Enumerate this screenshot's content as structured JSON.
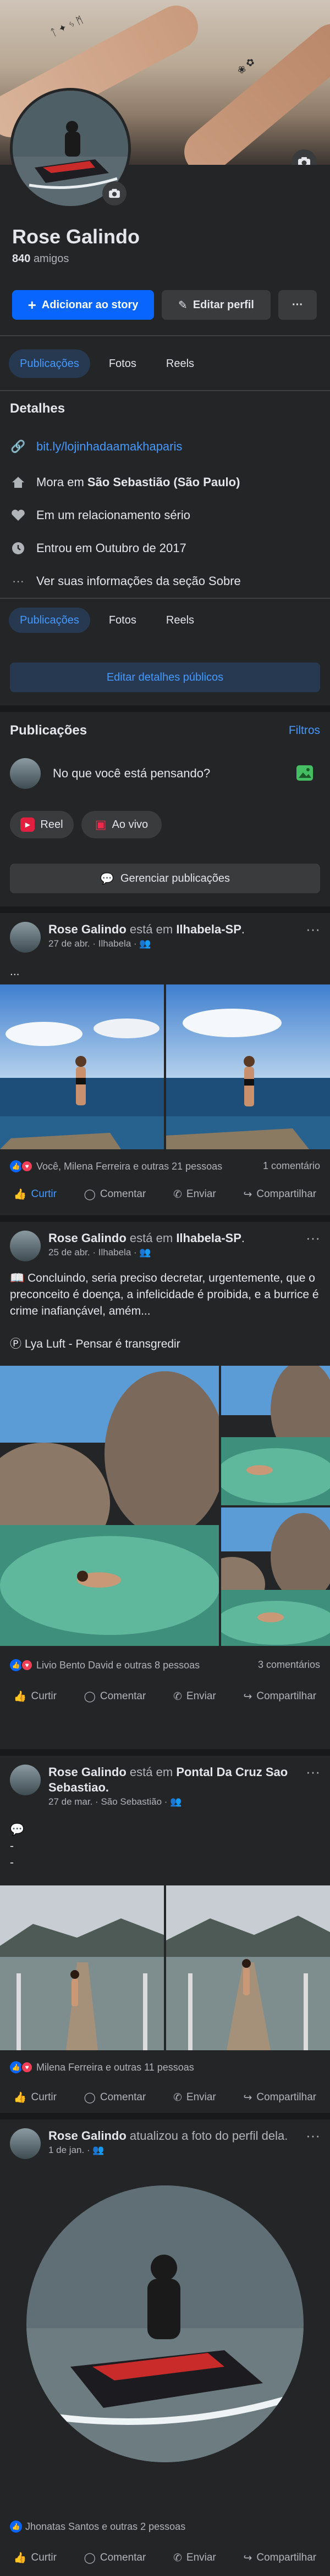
{
  "profile": {
    "name": "Rose Galindo",
    "friends_count": "840",
    "friends_label": "amigos",
    "add_story": "Adicionar ao story",
    "edit_profile": "Editar perfil",
    "more": "···"
  },
  "tabs": [
    "Publicações",
    "Fotos",
    "Reels"
  ],
  "details": {
    "title": "Detalhes",
    "link": "bit.ly/lojinhadaamakhaparis",
    "lives_prefix": "Mora em",
    "lives_place": "São Sebastião (São Paulo)",
    "relationship": "Em um relacionamento sério",
    "joined": "Entrou em Outubro de 2017",
    "about": "Ver suas informações da seção Sobre",
    "edit_public": "Editar detalhes públicos"
  },
  "posts_section": {
    "title": "Publicações",
    "filters": "Filtros",
    "composer_placeholder": "No que você está pensando?",
    "reel": "Reel",
    "live": "Ao vivo",
    "manage": "Gerenciar publicações"
  },
  "actions": {
    "like": "Curtir",
    "like_active": "Curtir",
    "comment": "Comentar",
    "send": "Enviar",
    "share": "Compartilhar"
  },
  "posts": [
    {
      "author": "Rose Galindo",
      "verb": "está em",
      "place": "Ilhabela-SP",
      "punct": ".",
      "date": "27 de abr.",
      "loc": "Ilhabela",
      "text": "...",
      "reactions": "Você, Milena Ferreira e outras 21 pessoas",
      "comments": "1 comentário"
    },
    {
      "author": "Rose Galindo",
      "verb": "está em",
      "place": "Ilhabela-SP",
      "punct": ".",
      "date": "25 de abr.",
      "loc": "Ilhabela",
      "text": "📖 Concluindo, seria preciso decretar, urgentemente, que o preconceito é doença, a infelicidade é proibida, e a burrice é crime inafiançável, amém...",
      "text2": "Lya Luft - Pensar é transgredir",
      "reactions": "Livio Bento David e outras 8 pessoas",
      "comments": "3 comentários"
    },
    {
      "author": "Rose Galindo",
      "verb": "está em",
      "place": "Pontal Da Cruz Sao Sebastiao.",
      "punct": "",
      "date": "27 de mar.",
      "loc": "São Sebastião",
      "text": "-",
      "text2": "-",
      "reactions": "Milena Ferreira e outras 11 pessoas",
      "comments": ""
    },
    {
      "author": "Rose Galindo",
      "verb": "atualizou a foto do perfil dela.",
      "date": "1 de jan.",
      "reactions": "Jhonatas Santos e outras 2 pessoas"
    }
  ],
  "colors": {
    "accent": "#0866ff",
    "bg": "#242526",
    "link": "#4599ff"
  }
}
